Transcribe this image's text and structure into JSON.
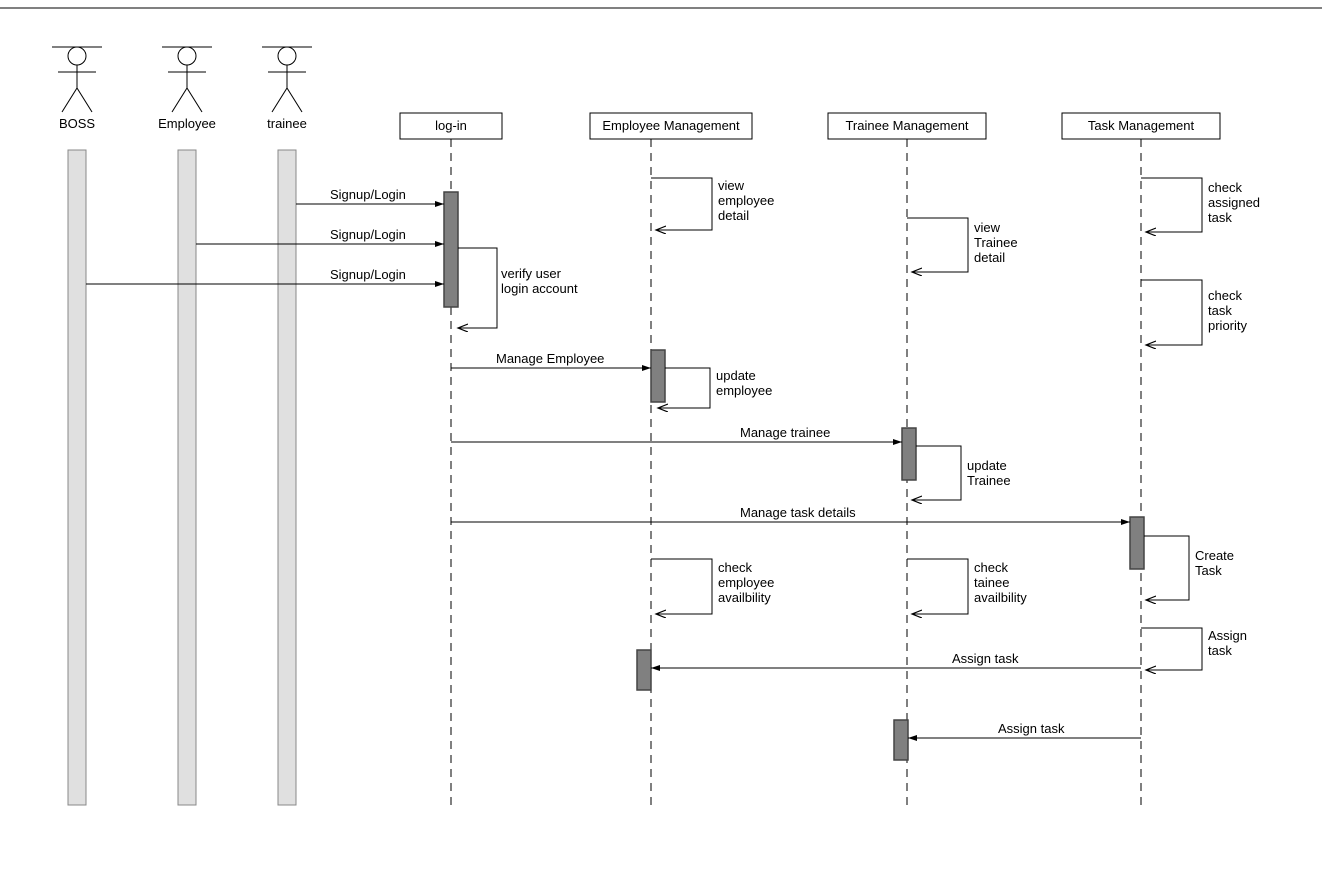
{
  "actors": {
    "boss": "BOSS",
    "employee": "Employee",
    "trainee": "trainee"
  },
  "objects": {
    "login": "log-in",
    "emp_mgmt": "Employee Management",
    "trn_mgmt": "Trainee Management",
    "task_mgmt": "Task Management"
  },
  "messages": {
    "signup_login_1": "Signup/Login",
    "signup_login_2": "Signup/Login",
    "signup_login_3": "Signup/Login",
    "verify_user_l1": "verify user",
    "verify_user_l2": "login account",
    "view_emp_l1": "view",
    "view_emp_l2": "employee",
    "view_emp_l3": "detail",
    "view_trn_l1": "view",
    "view_trn_l2": "Trainee",
    "view_trn_l3": "detail",
    "chk_assigned_l1": "check",
    "chk_assigned_l2": "assigned",
    "chk_assigned_l3": "task",
    "chk_priority_l1": "check",
    "chk_priority_l2": "task",
    "chk_priority_l3": "priority",
    "manage_emp": "Manage Employee",
    "update_emp_l1": "update",
    "update_emp_l2": "employee",
    "manage_trn": "Manage trainee",
    "update_trn_l1": "update",
    "update_trn_l2": "Trainee",
    "manage_task": "Manage task details",
    "create_task_l1": "Create",
    "create_task_l2": "Task",
    "chk_emp_avail_l1": "check",
    "chk_emp_avail_l2": "employee",
    "chk_emp_avail_l3": "availbility",
    "chk_trn_avail_l1": "check",
    "chk_trn_avail_l2": "tainee",
    "chk_trn_avail_l3": "availbility",
    "assign_task_txt": "Assign",
    "assign_task_txt2": "task",
    "assign_task_1": "Assign task",
    "assign_task_2": "Assign task"
  }
}
